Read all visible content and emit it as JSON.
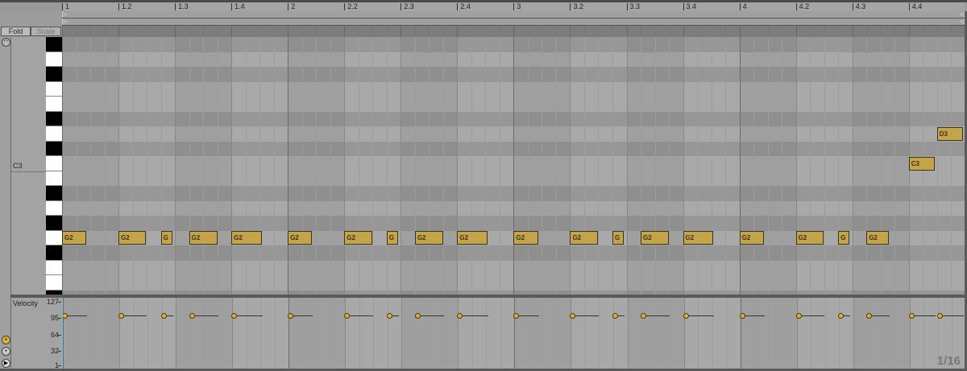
{
  "ruler": {
    "labels": [
      "1",
      "1.2",
      "1.3",
      "1.4",
      "2",
      "2.2",
      "2.3",
      "2.4",
      "3",
      "3.2",
      "3.3",
      "3.4",
      "4",
      "4.2",
      "4.3",
      "4.4"
    ]
  },
  "buttons": {
    "fold": "Fold",
    "scale": "Scale"
  },
  "keys": {
    "c3_label": "C3",
    "top_pitch": 68,
    "rows": 18
  },
  "notes": [
    {
      "label": "G2",
      "pitch": 55,
      "start": 0,
      "length": 0.43,
      "velocity": 100
    },
    {
      "label": "G2",
      "pitch": 55,
      "start": 1.0,
      "length": 0.49,
      "velocity": 100
    },
    {
      "label": "G",
      "pitch": 55,
      "start": 1.75,
      "length": 0.2,
      "velocity": 100
    },
    {
      "label": "G2",
      "pitch": 55,
      "start": 2.25,
      "length": 0.5,
      "velocity": 100
    },
    {
      "label": "G2",
      "pitch": 55,
      "start": 3.0,
      "length": 0.54,
      "velocity": 100
    },
    {
      "label": "G2",
      "pitch": 55,
      "start": 4.0,
      "length": 0.43,
      "velocity": 100
    },
    {
      "label": "G2",
      "pitch": 55,
      "start": 5.0,
      "length": 0.49,
      "velocity": 100
    },
    {
      "label": "G",
      "pitch": 55,
      "start": 5.75,
      "length": 0.2,
      "velocity": 100
    },
    {
      "label": "G2",
      "pitch": 55,
      "start": 6.25,
      "length": 0.5,
      "velocity": 100
    },
    {
      "label": "G2",
      "pitch": 55,
      "start": 7.0,
      "length": 0.54,
      "velocity": 100
    },
    {
      "label": "G2",
      "pitch": 55,
      "start": 8.0,
      "length": 0.43,
      "velocity": 100
    },
    {
      "label": "G2",
      "pitch": 55,
      "start": 9.0,
      "length": 0.49,
      "velocity": 100
    },
    {
      "label": "G",
      "pitch": 55,
      "start": 9.75,
      "length": 0.2,
      "velocity": 100
    },
    {
      "label": "G2",
      "pitch": 55,
      "start": 10.25,
      "length": 0.5,
      "velocity": 100
    },
    {
      "label": "G2",
      "pitch": 55,
      "start": 11.0,
      "length": 0.54,
      "velocity": 100
    },
    {
      "label": "G2",
      "pitch": 55,
      "start": 12.0,
      "length": 0.43,
      "velocity": 100
    },
    {
      "label": "G2",
      "pitch": 55,
      "start": 13.0,
      "length": 0.49,
      "velocity": 100
    },
    {
      "label": "G",
      "pitch": 55,
      "start": 13.75,
      "length": 0.2,
      "velocity": 100
    },
    {
      "label": "G2",
      "pitch": 55,
      "start": 14.25,
      "length": 0.39,
      "velocity": 100
    },
    {
      "label": "C3",
      "pitch": 60,
      "start": 15.0,
      "length": 0.46,
      "velocity": 100
    },
    {
      "label": "D3",
      "pitch": 62,
      "start": 15.5,
      "length": 0.46,
      "velocity": 100
    }
  ],
  "velocity": {
    "label": "Velocity",
    "ticks": [
      "127",
      "95",
      "64",
      "32",
      "1"
    ]
  },
  "grid_label": "1/16",
  "colors": {
    "note": "#c4a448",
    "accent": "#6cc4dc"
  }
}
